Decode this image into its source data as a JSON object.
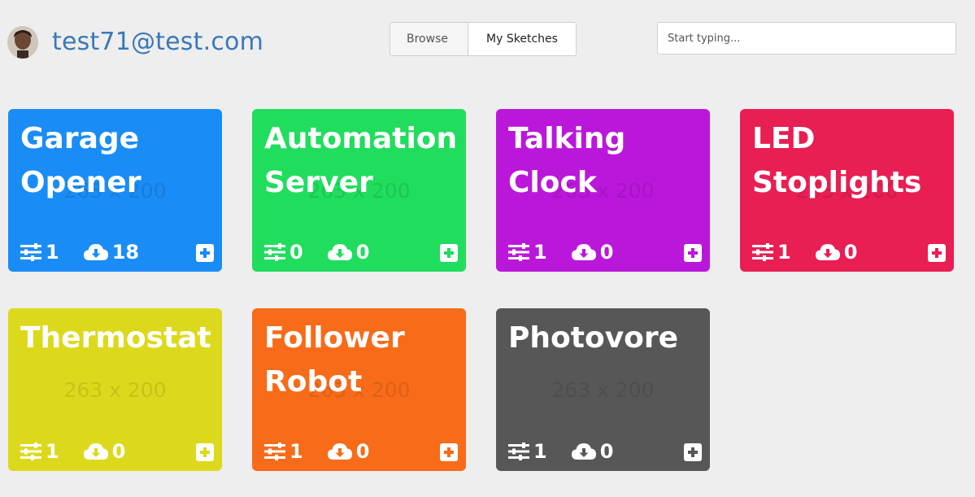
{
  "header": {
    "user_email": "test71@test.com",
    "tabs": [
      {
        "label": "Browse"
      },
      {
        "label": "My Sketches"
      }
    ],
    "search_placeholder": "Start typing..."
  },
  "cards": [
    {
      "title_line1": "Garage",
      "title_line2": "Opener",
      "watermark": "263 x 200",
      "controls": "1",
      "downloads": "18",
      "color": "#1a8cf5"
    },
    {
      "title_line1": "Automation",
      "title_line2": "Server",
      "watermark": "263 x 200",
      "controls": "0",
      "downloads": "0",
      "color": "#20dd5e"
    },
    {
      "title_line1": "Talking",
      "title_line2": "Clock",
      "watermark": "263 x 200",
      "controls": "1",
      "downloads": "0",
      "color": "#bb17da"
    },
    {
      "title_line1": "LED",
      "title_line2": "Stoplights",
      "watermark": "263 x 200",
      "controls": "1",
      "downloads": "0",
      "color": "#e91e52"
    },
    {
      "title_line1": "Thermostat",
      "title_line2": "",
      "watermark": "263 x 200",
      "controls": "1",
      "downloads": "0",
      "color": "#dcd91c"
    },
    {
      "title_line1": "Follower",
      "title_line2": "Robot",
      "watermark": "263 x 200",
      "controls": "1",
      "downloads": "0",
      "color": "#f76b19"
    },
    {
      "title_line1": "Photovore",
      "title_line2": "",
      "watermark": "263 x 200",
      "controls": "1",
      "downloads": "0",
      "color": "#575757"
    }
  ]
}
